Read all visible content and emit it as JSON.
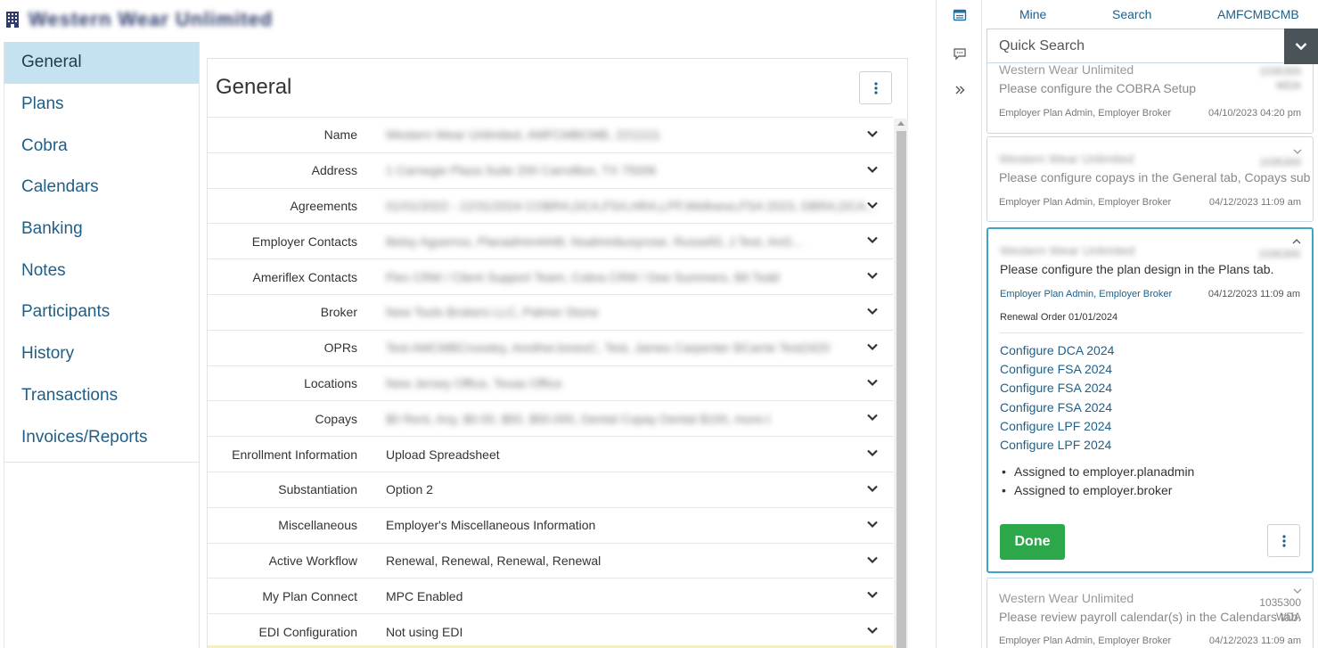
{
  "header": {
    "company": "Western Wear Unlimited"
  },
  "leftnav": {
    "items": [
      {
        "label": "General",
        "active": true
      },
      {
        "label": "Plans"
      },
      {
        "label": "Cobra"
      },
      {
        "label": "Calendars"
      },
      {
        "label": "Banking"
      },
      {
        "label": "Notes"
      },
      {
        "label": "Participants"
      },
      {
        "label": "History"
      },
      {
        "label": "Transactions"
      },
      {
        "label": "Invoices/Reports"
      }
    ]
  },
  "main": {
    "title": "General",
    "rows": [
      {
        "label": "Name",
        "value": "Western Wear Unlimited, AMFCMBCMB, 2211111",
        "blurred": true
      },
      {
        "label": "Address",
        "value": "1 Carnegie Plaza Suite 200 Carrollton, TX 75006",
        "blurred": true
      },
      {
        "label": "Agreements",
        "value": "01/01/2022 - 12/31/2024 COBRA,DCA,FSA,HRA,LPF,Wellness,FSA 2023, DBRA,DCA...",
        "blurred": true
      },
      {
        "label": "Employer Contacts",
        "value": "Betsy Aguerros, Planadmin4448, Nsalminbusyrose, Russell3, J.Test, AnG...",
        "blurred": true
      },
      {
        "label": "Ameriflex Contacts",
        "value": "Flex CRM / Client Support Team, Cobra CRM / Dee Summers, Bit Todd",
        "blurred": true
      },
      {
        "label": "Broker",
        "value": "New Tools Brokers LLC, Palmer Stone",
        "blurred": true
      },
      {
        "label": "OPRs",
        "value": "Test AMCMBCrossley, AnotherJonesC, Test, James Carpenter BCarrie Test2420",
        "blurred": true
      },
      {
        "label": "Locations",
        "value": "New Jersey Office, Texas Office",
        "blurred": true
      },
      {
        "label": "Copays",
        "value": "$0 Rent, Any, $0.00, $50, $50.000, Dental Copay Dental $100, more.t",
        "blurred": true
      },
      {
        "label": "Enrollment Information",
        "value": "Upload Spreadsheet",
        "blurred": false
      },
      {
        "label": "Substantiation",
        "value": "Option 2",
        "blurred": false
      },
      {
        "label": "Miscellaneous",
        "value": "Employer's Miscellaneous Information",
        "blurred": false
      },
      {
        "label": "Active Workflow",
        "value": "Renewal, Renewal, Renewal, Renewal",
        "blurred": false
      },
      {
        "label": "My Plan Connect",
        "value": "MPC Enabled",
        "blurred": false
      },
      {
        "label": "EDI Configuration",
        "value": "Not using EDI",
        "blurred": false
      }
    ]
  },
  "rpanel": {
    "tabs": {
      "mine": "Mine",
      "search": "Search",
      "code": "AMFCMBCMB"
    },
    "quick_search_placeholder": "Quick Search",
    "cards": [
      {
        "title": "Western Wear Unlimited",
        "message": "Please configure the COBRA Setup",
        "assignees": "Employer Plan Admin, Employer Broker",
        "date": "04/10/2023 04:20 pm",
        "id": "1035300",
        "id2": "WDA"
      },
      {
        "title": "Western Wear Unlimited",
        "message": "Please configure copays in the General tab, Copays sub",
        "assignees": "Employer Plan Admin, Employer Broker",
        "date": "04/12/2023 11:09 am",
        "id": "1035300",
        "id2": "WDA"
      },
      {
        "title": "Western Wear Unlimited",
        "message": "Please configure the plan design in the Plans tab.",
        "assignees": "Employer Plan Admin, Employer Broker",
        "date": "04/12/2023 11:09 am",
        "id": "1035300",
        "renewal": "Renewal Order 01/01/2024",
        "links": [
          "Configure DCA 2024",
          "Configure FSA 2024",
          "Configure FSA 2024",
          "Configure FSA 2024",
          "Configure LPF 2024",
          "Configure LPF 2024"
        ],
        "bullets": [
          "Assigned to employer.planadmin",
          "Assigned to employer.broker"
        ],
        "done_label": "Done"
      },
      {
        "title": "Western Wear Unlimited",
        "message": "Please review payroll calendar(s) in the Calendars tab.",
        "assignees": "Employer Plan Admin, Employer Broker",
        "date": "04/12/2023 11:09 am",
        "id": "1035300",
        "id2": "WDA"
      }
    ]
  }
}
